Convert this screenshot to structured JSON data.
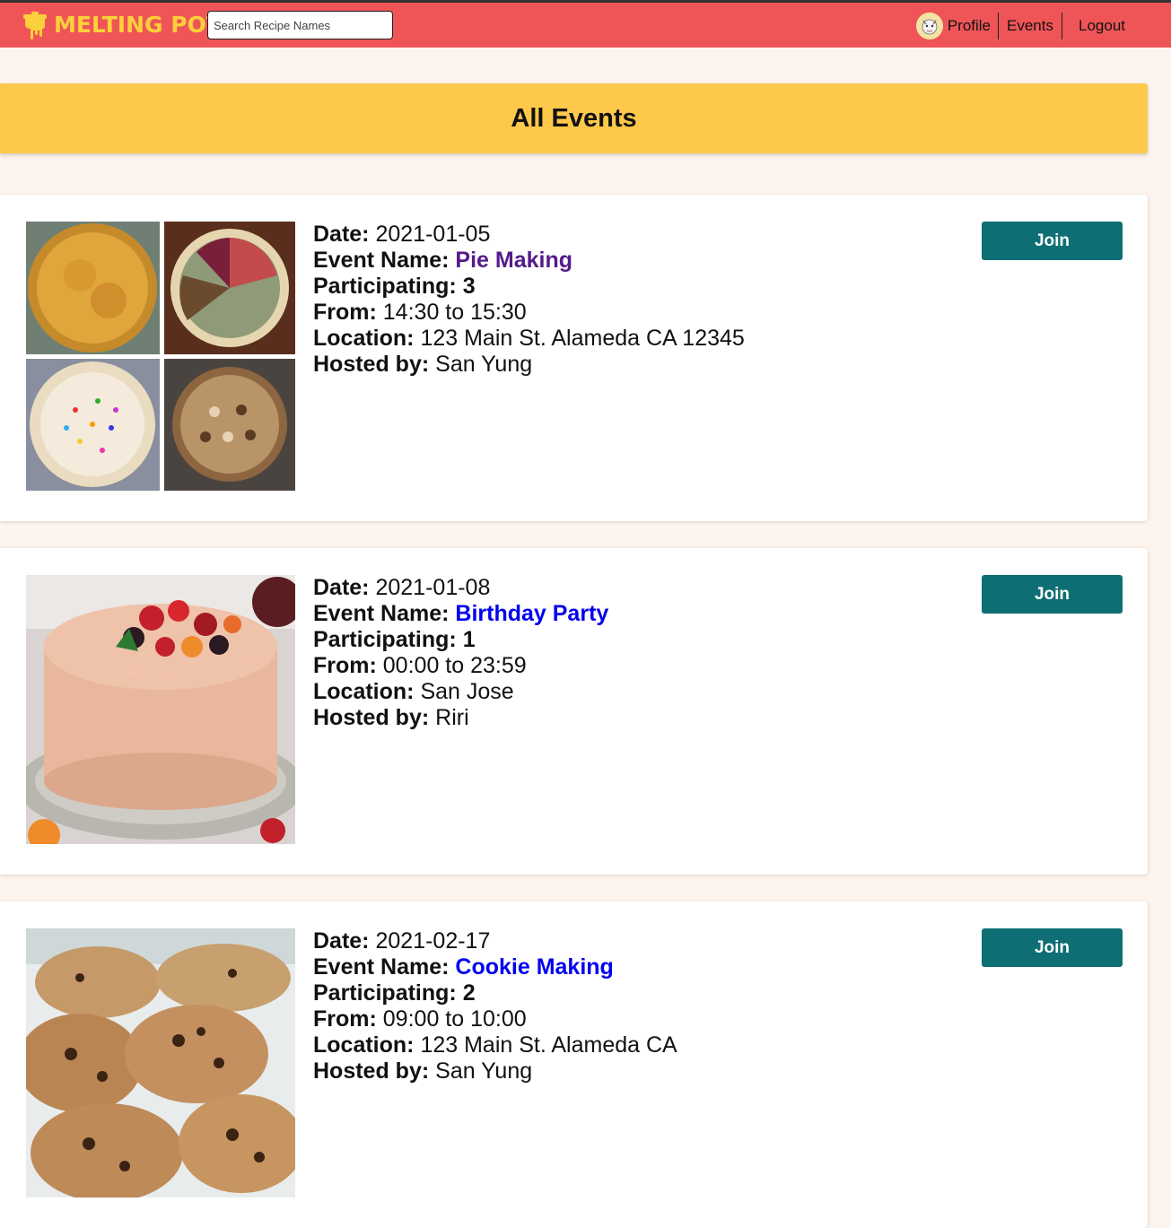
{
  "brand": {
    "name": "MELTING POT"
  },
  "search": {
    "placeholder": "Search Recipe Names"
  },
  "nav": {
    "profile": "Profile",
    "events": "Events",
    "logout": "Logout"
  },
  "page": {
    "title": "All Events"
  },
  "labels": {
    "date": "Date:",
    "event_name": "Event Name:",
    "participating": "Participating:",
    "from": "From:",
    "location": "Location:",
    "hosted_by": "Hosted by:",
    "join": "Join"
  },
  "colors": {
    "navbar": "#ef5557",
    "brand": "#fcd03a",
    "banner": "#fec84a",
    "join_button": "#0e6e73",
    "visited_link": "#551a8b",
    "link": "#0000ee"
  },
  "events": [
    {
      "date": "2021-01-05",
      "name": "Pie Making",
      "participating": "3",
      "from_to": "14:30 to 15:30",
      "location": "123 Main St. Alameda CA 12345",
      "host": "San Yung",
      "link_state": "visited",
      "image": "pie-collage-image"
    },
    {
      "date": "2021-01-08",
      "name": "Birthday Party",
      "participating": "1",
      "from_to": "00:00 to 23:59",
      "location": "San Jose",
      "host": "Riri",
      "link_state": "unvisited",
      "image": "birthday-cake-image"
    },
    {
      "date": "2021-02-17",
      "name": "Cookie Making",
      "participating": "2",
      "from_to": "09:00 to 10:00",
      "location": "123 Main St. Alameda CA",
      "host": "San Yung",
      "link_state": "unvisited",
      "image": "cookies-image"
    }
  ]
}
